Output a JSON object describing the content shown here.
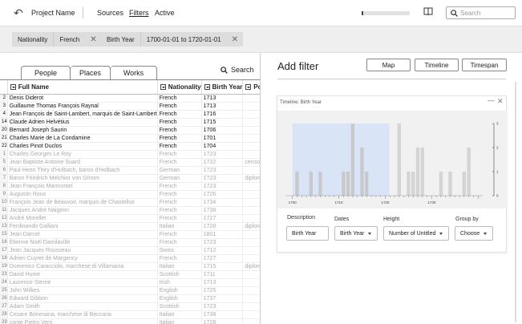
{
  "header": {
    "project_name": "Project Name",
    "nav": [
      "Sources",
      "Filters",
      "Active"
    ],
    "search_placeholder": "Search"
  },
  "filters": [
    {
      "key": "Nationality",
      "value": "French"
    },
    {
      "key": "Birth Year",
      "value": "1700-01-01 to 1720-01-01"
    }
  ],
  "progress": 0.02,
  "left": {
    "tabs": [
      "People",
      "Places",
      "Works"
    ],
    "search_label": "Search",
    "columns": [
      "Full Name",
      "Nationality",
      "Birth Year",
      "Po"
    ],
    "rows": [
      {
        "n": "2",
        "name": "Denis Diderot",
        "nat": "French",
        "year": "1713",
        "extra": "",
        "on": true
      },
      {
        "n": "3",
        "name": "Guillaume Thomas François Raynal",
        "nat": "French",
        "year": "1713",
        "extra": "",
        "on": true
      },
      {
        "n": "4",
        "name": "Jean François de Saint-Lambert, marquis de Saint-Lambert",
        "nat": "French",
        "year": "1716",
        "extra": "",
        "on": true
      },
      {
        "n": "14",
        "name": "Claude Adrien Helvétius",
        "nat": "French",
        "year": "1715",
        "extra": "",
        "on": true
      },
      {
        "n": "20",
        "name": "Bernard Joseph Saurin",
        "nat": "French",
        "year": "1706",
        "extra": "",
        "on": true
      },
      {
        "n": "21",
        "name": "Charles Marie de La Condamine",
        "nat": "French",
        "year": "1701",
        "extra": "",
        "on": true
      },
      {
        "n": "22",
        "name": "Charles Pinot Duclos",
        "nat": "French",
        "year": "1704",
        "extra": "",
        "on": true
      },
      {
        "n": "1",
        "name": "Charles Georges Le Roy",
        "nat": "French",
        "year": "1723",
        "extra": "",
        "on": false
      },
      {
        "n": "5",
        "name": "Jean Baptiste Antoine Suard",
        "nat": "French",
        "year": "1732",
        "extra": "censor",
        "on": false
      },
      {
        "n": "6",
        "name": "Paul Henri Thiry d'Holbach, baron d'Holbach",
        "nat": "German",
        "year": "1723",
        "extra": "",
        "on": false
      },
      {
        "n": "7",
        "name": "Baron Friedrich Melchior von Grimm",
        "nat": "German",
        "year": "1723",
        "extra": "diploma",
        "on": false
      },
      {
        "n": "8",
        "name": "Jean François Marmontel",
        "nat": "French",
        "year": "1723",
        "extra": "",
        "on": false
      },
      {
        "n": "9",
        "name": "Augustin Roux",
        "nat": "French",
        "year": "1726",
        "extra": "",
        "on": false
      },
      {
        "n": "10",
        "name": "François Jean de Beauvoir, marquis de Chastellux",
        "nat": "French",
        "year": "1734",
        "extra": "",
        "on": false
      },
      {
        "n": "11",
        "name": "Jacques André Naigeon",
        "nat": "French",
        "year": "1738",
        "extra": "",
        "on": false
      },
      {
        "n": "12",
        "name": "André Morellet",
        "nat": "French",
        "year": "1727",
        "extra": "",
        "on": false
      },
      {
        "n": "13",
        "name": "Ferdinando Galliani",
        "nat": "Italian",
        "year": "1728",
        "extra": "diploma",
        "on": false
      },
      {
        "n": "15",
        "name": "Jean Darcet",
        "nat": "French",
        "year": "1801",
        "extra": "",
        "on": false
      },
      {
        "n": "16",
        "name": "Étienne Noël Damilaville",
        "nat": "French",
        "year": "1723",
        "extra": "",
        "on": false
      },
      {
        "n": "17",
        "name": "Jean Jacques Rousseau",
        "nat": "Swiss",
        "year": "1712",
        "extra": "",
        "on": false
      },
      {
        "n": "18",
        "name": "Adrien Cuyret de Margency",
        "nat": "French",
        "year": "1727",
        "extra": "",
        "on": false
      },
      {
        "n": "19",
        "name": "Domenico Caracciolo, marchese di Villamaina",
        "nat": "Italian",
        "year": "1715",
        "extra": "diploma",
        "on": false
      },
      {
        "n": "23",
        "name": "David Hume",
        "nat": "Scottish",
        "year": "1711",
        "extra": "",
        "on": false
      },
      {
        "n": "24",
        "name": "Laurence Sterne",
        "nat": "Irish",
        "year": "1713",
        "extra": "",
        "on": false
      },
      {
        "n": "25",
        "name": "John Wilkes",
        "nat": "English",
        "year": "1725",
        "extra": "",
        "on": false
      },
      {
        "n": "26",
        "name": "Edward Gibbon",
        "nat": "English",
        "year": "1737",
        "extra": "",
        "on": false
      },
      {
        "n": "27",
        "name": "Adam Smith",
        "nat": "Scottish",
        "year": "1723",
        "extra": "",
        "on": false
      },
      {
        "n": "28",
        "name": "Cesare Bonesana, marchese di Beccaria",
        "nat": "Italian",
        "year": "1738",
        "extra": "",
        "on": false
      },
      {
        "n": "29",
        "name": "conte Pietro Verri",
        "nat": "Italian",
        "year": "1728",
        "extra": "",
        "on": false
      },
      {
        "n": "30",
        "name": "conte Alessandro Verri",
        "nat": "Italian",
        "year": "1741",
        "extra": "",
        "on": false
      }
    ]
  },
  "right": {
    "title": "Add filter",
    "buttons": [
      "Map",
      "Timeline",
      "Timespan"
    ],
    "card_title": "Timeline: Birth Year",
    "fields": {
      "description": {
        "label": "Description",
        "value": "Birth Year"
      },
      "dates": {
        "label": "Dates",
        "value": "Birth Year"
      },
      "height": {
        "label": "Height",
        "value": "Number of Untitled"
      },
      "groupby": {
        "label": "Group by",
        "value": "Choose"
      }
    }
  },
  "chart_data": {
    "type": "bar",
    "x_ticks": [
      "1700",
      "1710",
      "1720",
      "1730"
    ],
    "y_ticks": [
      "0",
      "1",
      "2",
      "3"
    ],
    "ylim": [
      0,
      3
    ],
    "selection": {
      "from": 1700,
      "to": 1720
    },
    "bars": [
      {
        "x": 1701,
        "value": 1
      },
      {
        "x": 1704,
        "value": 1
      },
      {
        "x": 1706,
        "value": 1
      },
      {
        "x": 1711,
        "value": 1
      },
      {
        "x": 1712,
        "value": 1
      },
      {
        "x": 1713,
        "value": 3
      },
      {
        "x": 1715,
        "value": 2
      },
      {
        "x": 1716,
        "value": 1
      },
      {
        "x": 1723,
        "value": 3
      },
      {
        "x": 1725,
        "value": 1
      },
      {
        "x": 1726,
        "value": 1
      },
      {
        "x": 1727,
        "value": 2
      },
      {
        "x": 1728,
        "value": 2
      },
      {
        "x": 1732,
        "value": 1
      },
      {
        "x": 1734,
        "value": 1
      },
      {
        "x": 1737,
        "value": 1
      },
      {
        "x": 1738,
        "value": 2
      }
    ]
  }
}
